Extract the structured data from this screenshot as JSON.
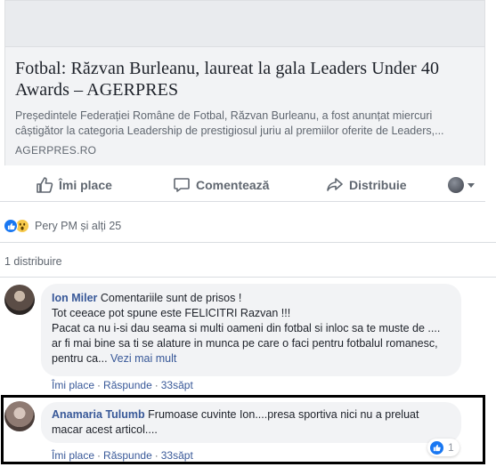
{
  "link_preview": {
    "title": "Fotbal: Răzvan Burleanu, laureat la gala Leaders Under 40 Awards – AGERPRES",
    "description": "Președintele Federației Române de Fotbal, Răzvan Burleanu, a fost anunțat miercuri câștigător la categoria Leadership de prestigiosul juriu al premiilor oferite de Leaders,...",
    "domain": "AGERPRES.RO"
  },
  "actions": {
    "like_label": "Îmi place",
    "comment_label": "Comentează",
    "share_label": "Distribuie"
  },
  "reactions": {
    "summary": "Pery PM și alți 25",
    "types": [
      "like-icon",
      "wow-icon"
    ]
  },
  "shares": {
    "text": "1 distribuire"
  },
  "comments": [
    {
      "author": "Ion Miler",
      "text": "Comentariile sunt de prisos !\nTot ceeace pot spune este FELICITRI Razvan !!!\nPacat ca nu i-si dau seama si multi oameni din fotbal si inloc sa te muste de .... ar fi mai bine sa ti se alature in munca pe care o faci pentru fotbalul romanesc, pentru ca...",
      "see_more": "Vezi mai mult",
      "like": "Îmi place",
      "reply": "Răspunde",
      "time": "33săpt"
    },
    {
      "author": "Anamaria Tulumb",
      "text": "Frumoase cuvinte Ion....presa sportiva nici nu a preluat macar acest articol....",
      "like": "Îmi place",
      "reply": "Răspunde",
      "time": "33săpt",
      "reaction_count": "1"
    }
  ],
  "colors": {
    "link_blue": "#385898",
    "like_blue": "#1877f2",
    "muted": "#606770",
    "bubble": "#f2f3f5"
  }
}
